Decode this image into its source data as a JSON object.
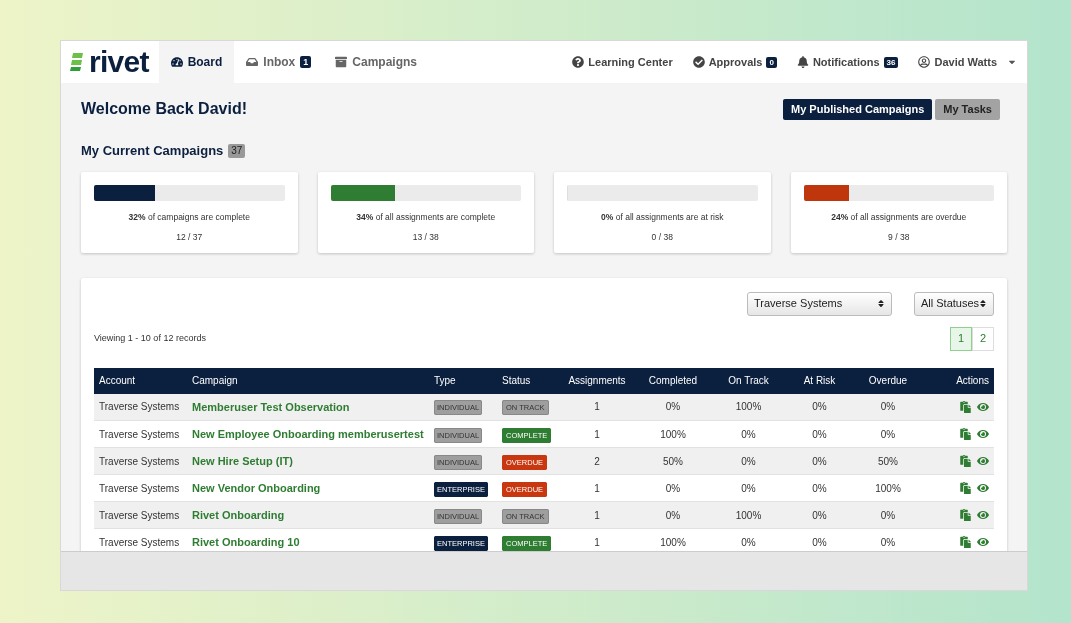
{
  "nav": {
    "logo": "rivet",
    "tabs": [
      {
        "label": "Board",
        "selected": true
      },
      {
        "label": "Inbox",
        "badge": "1",
        "selected": false
      },
      {
        "label": "Campaigns",
        "selected": false
      }
    ],
    "links": [
      {
        "label": "Learning Center"
      },
      {
        "label": "Approvals",
        "badge": "0"
      },
      {
        "label": "Notifications",
        "badge": "36"
      },
      {
        "label": "David Watts",
        "menu": true
      }
    ]
  },
  "welcome": "Welcome Back David!",
  "view_buttons": [
    {
      "label": "My Published Campaigns",
      "selected": true
    },
    {
      "label": "My Tasks",
      "selected": false
    }
  ],
  "section": {
    "title": "My Current Campaigns",
    "count": "37"
  },
  "stats": [
    {
      "level": 0.32,
      "color": "#0b1f3f",
      "text": "**32%** of campaigns are complete",
      "ratio": "12 / 37"
    },
    {
      "level": 0.34,
      "color": "#2e7d32",
      "text": "**34%** of all assignments are complete",
      "ratio": "13 / 38"
    },
    {
      "level": 0,
      "text": "**0%** of all assignments are at risk",
      "ratio": "0 / 38"
    },
    {
      "level": 0.24,
      "color": "#c0360c",
      "text": "**24%** of all assignments are overdue",
      "ratio": "9 / 38"
    }
  ],
  "filters": [
    {
      "value": "Traverse Systems"
    },
    {
      "value": "All Statuses"
    }
  ],
  "records": "Viewing 1 - 10 of 12 records",
  "pages": [
    {
      "label": "1",
      "selected": true
    },
    {
      "label": "2",
      "selected": false
    }
  ],
  "table": {
    "columns": [
      "Account",
      "Campaign",
      "Type",
      "Status",
      "Assignments",
      "Completed",
      "On Track",
      "At Risk",
      "Overdue",
      "Actions"
    ],
    "rows": [
      {
        "account": "Traverse Systems",
        "campaign": "Memberuser Test Observation",
        "type": {
          "label": "INDIVIDUAL",
          "kind": "individual"
        },
        "status": {
          "label": "ON TRACK",
          "kind": "on_track"
        },
        "assignments": "1",
        "completed": "0%",
        "on_track": "100%",
        "at_risk": "0%",
        "overdue": "0%"
      },
      {
        "account": "Traverse Systems",
        "campaign": "New Employee Onboarding memberusertest",
        "type": {
          "label": "INDIVIDUAL",
          "kind": "individual"
        },
        "status": {
          "label": "COMPLETE",
          "kind": "complete"
        },
        "assignments": "1",
        "completed": "100%",
        "on_track": "0%",
        "at_risk": "0%",
        "overdue": "0%"
      },
      {
        "account": "Traverse Systems",
        "campaign": "New Hire Setup (IT)",
        "type": {
          "label": "INDIVIDUAL",
          "kind": "individual"
        },
        "status": {
          "label": "OVERDUE",
          "kind": "overdue"
        },
        "assignments": "2",
        "completed": "50%",
        "on_track": "0%",
        "at_risk": "0%",
        "overdue": "50%"
      },
      {
        "account": "Traverse Systems",
        "campaign": "New Vendor Onboarding",
        "type": {
          "label": "ENTERPRISE",
          "kind": "enterprise"
        },
        "status": {
          "label": "OVERDUE",
          "kind": "overdue"
        },
        "assignments": "1",
        "completed": "0%",
        "on_track": "0%",
        "at_risk": "0%",
        "overdue": "100%"
      },
      {
        "account": "Traverse Systems",
        "campaign": "Rivet Onboarding",
        "type": {
          "label": "INDIVIDUAL",
          "kind": "individual"
        },
        "status": {
          "label": "ON TRACK",
          "kind": "on_track"
        },
        "assignments": "1",
        "completed": "0%",
        "on_track": "100%",
        "at_risk": "0%",
        "overdue": "0%"
      },
      {
        "account": "Traverse Systems",
        "campaign": "Rivet Onboarding 10",
        "type": {
          "label": "ENTERPRISE",
          "kind": "enterprise"
        },
        "status": {
          "label": "COMPLETE",
          "kind": "complete"
        },
        "assignments": "1",
        "completed": "100%",
        "on_track": "0%",
        "at_risk": "0%",
        "overdue": "0%"
      }
    ]
  }
}
